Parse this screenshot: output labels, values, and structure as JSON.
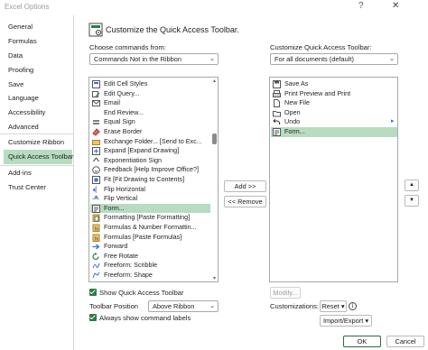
{
  "window": {
    "title": "Excel Options",
    "help_glyph": "?",
    "close_glyph": "✕"
  },
  "sidebar": {
    "items": [
      {
        "label": "General"
      },
      {
        "label": "Formulas"
      },
      {
        "label": "Data"
      },
      {
        "label": "Proofing"
      },
      {
        "label": "Save"
      },
      {
        "label": "Language"
      },
      {
        "label": "Accessibility"
      },
      {
        "label": "Advanced"
      },
      {
        "label": "Customize Ribbon"
      },
      {
        "label": "Quick Access Toolbar",
        "selected": true
      },
      {
        "label": "Add-ins"
      },
      {
        "label": "Trust Center"
      }
    ]
  },
  "main": {
    "heading": "Customize the Quick Access Toolbar.",
    "choose_label": "Choose commands from:",
    "choose_value": "Commands Not in the Ribbon",
    "customize_label": "Customize Quick Access Toolbar:",
    "customize_value": "For all documents (default)",
    "commands": [
      {
        "label": "Edit Cell Styles",
        "icon": "cell-styles-icon"
      },
      {
        "label": "Edit Query...",
        "icon": "edit-query-icon"
      },
      {
        "label": "Email",
        "icon": "email-icon"
      },
      {
        "label": "End Review...",
        "icon": "blank-icon"
      },
      {
        "label": "Equal Sign",
        "icon": "equal-sign-icon"
      },
      {
        "label": "Erase Border",
        "icon": "eraser-icon"
      },
      {
        "label": "Exchange Folder... [Send to Exc...",
        "icon": "exchange-folder-icon"
      },
      {
        "label": "Expand [Expand Drawing]",
        "icon": "expand-icon"
      },
      {
        "label": "Exponentiation Sign",
        "icon": "exponent-icon"
      },
      {
        "label": "Feedback [Help Improve Office?]",
        "icon": "feedback-icon"
      },
      {
        "label": "Fit [Fit Drawing to Contents]",
        "icon": "fit-icon"
      },
      {
        "label": "Flip Horizontal",
        "icon": "flip-horizontal-icon"
      },
      {
        "label": "Flip Vertical",
        "icon": "flip-vertical-icon"
      },
      {
        "label": "Form...",
        "icon": "form-icon",
        "selected": true
      },
      {
        "label": "Formatting [Paste Formatting]",
        "icon": "paste-format-icon"
      },
      {
        "label": "Formulas & Number Formattin...",
        "icon": "paste-formulas-icon"
      },
      {
        "label": "Formulas [Paste Formulas]",
        "icon": "paste-formulas-icon"
      },
      {
        "label": "Forward",
        "icon": "forward-icon"
      },
      {
        "label": "Free Rotate",
        "icon": "rotate-icon"
      },
      {
        "label": "Freeform: Scribble",
        "icon": "scribble-icon"
      },
      {
        "label": "Freeform: Shape",
        "icon": "freeform-icon"
      }
    ],
    "commands_sub_glyph": "▾",
    "toolbar": [
      {
        "label": "Save As",
        "icon": "save-as-icon"
      },
      {
        "label": "Print Preview and Print",
        "icon": "print-preview-icon"
      },
      {
        "label": "New File",
        "icon": "new-file-icon"
      },
      {
        "label": "Open",
        "icon": "open-icon"
      },
      {
        "label": "Undo",
        "icon": "undo-icon",
        "sub": "▸"
      },
      {
        "label": "Form...",
        "icon": "form-icon",
        "selected": true
      }
    ],
    "add_button": "Add >>",
    "remove_button": "<< Remove",
    "modify_button": "Modify...",
    "show_qat_label": "Show Quick Access Toolbar",
    "toolbar_position_label": "Toolbar Position",
    "toolbar_position_value": "Above Ribbon",
    "always_show_labels": "Always show command labels",
    "customizations_label": "Customizations:",
    "reset_button": "Reset ▾",
    "import_export_button": "Import/Export ▾",
    "ok_button": "OK",
    "cancel_button": "Cancel",
    "move_up_glyph": "▲",
    "move_down_glyph": "▼"
  },
  "colors": {
    "selection": "#b7dcc0",
    "checkbox": "#2e7a44",
    "primary_border": "#2e6a3c"
  }
}
